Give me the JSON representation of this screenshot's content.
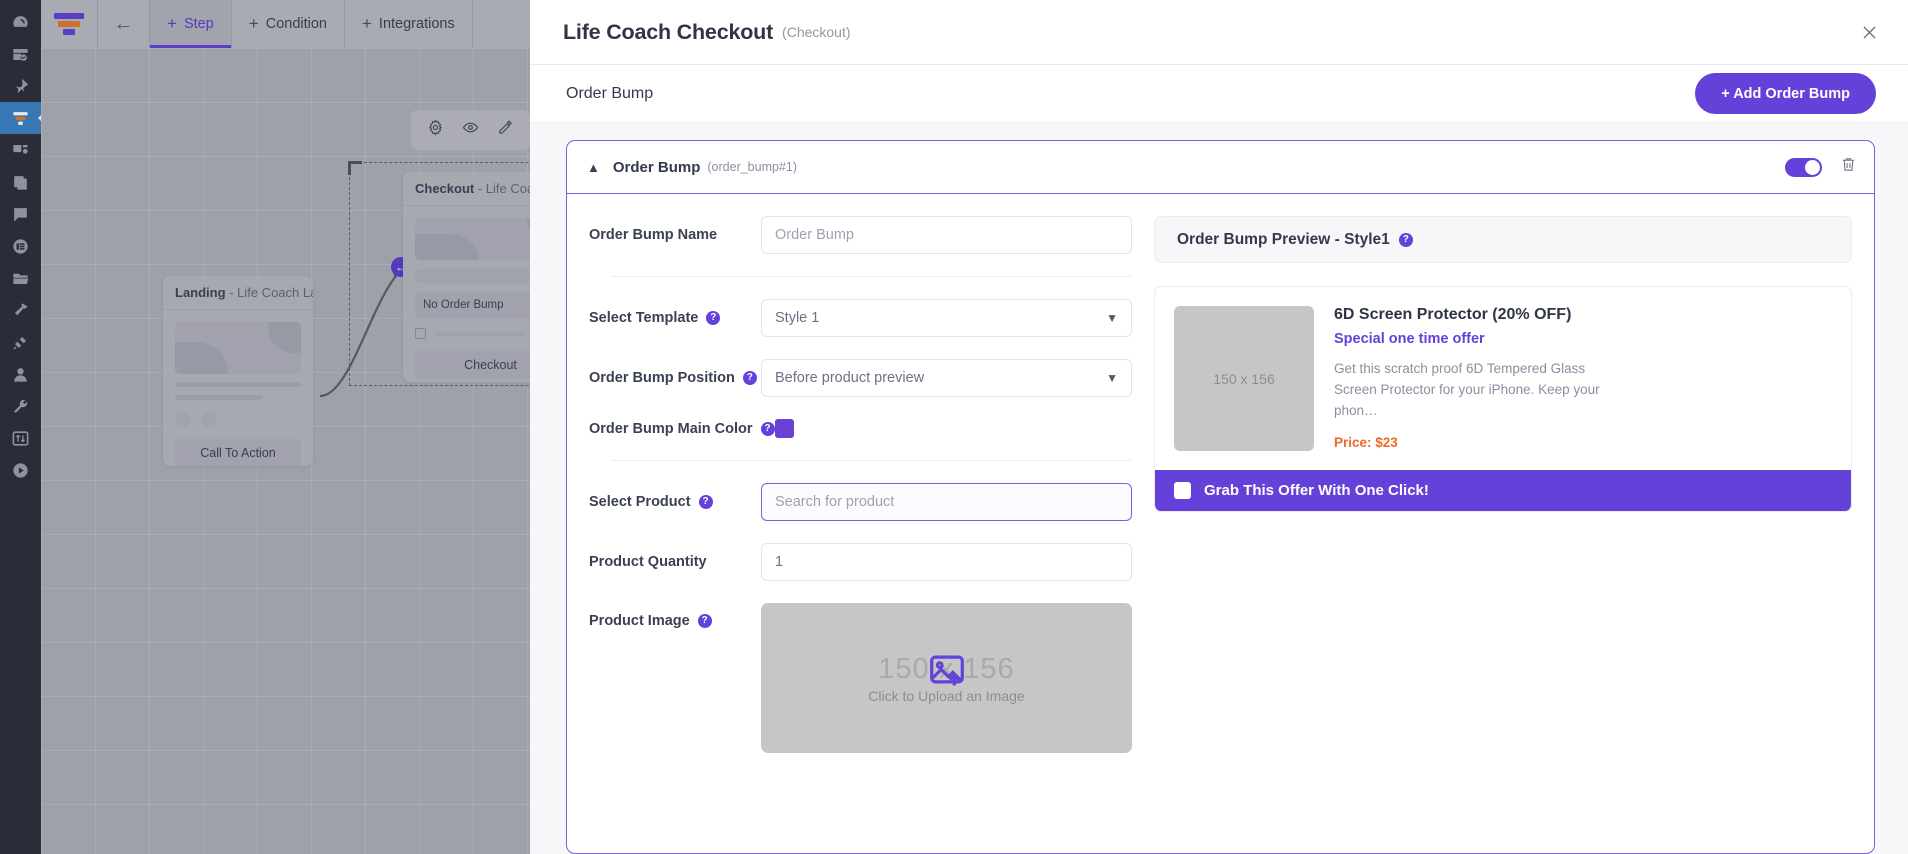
{
  "sidebar": {
    "items": [
      {
        "name": "dashboard-icon",
        "label": "Dashboard"
      },
      {
        "name": "pages-check-icon",
        "label": "Pages"
      },
      {
        "name": "pin-icon",
        "label": "Pinned"
      },
      {
        "name": "funnel-icon",
        "label": "Funnels"
      },
      {
        "name": "media-icon",
        "label": "Media"
      },
      {
        "name": "copy-icon",
        "label": "Templates"
      },
      {
        "name": "chat-icon",
        "label": "Messages"
      },
      {
        "name": "contacts-icon",
        "label": "Contacts"
      },
      {
        "name": "folder-icon",
        "label": "Files"
      },
      {
        "name": "hammer-icon",
        "label": "Builder"
      },
      {
        "name": "plug-icon",
        "label": "Integrations"
      },
      {
        "name": "user-icon",
        "label": "Users"
      },
      {
        "name": "wrench-icon",
        "label": "Tools"
      },
      {
        "name": "sliders-icon",
        "label": "Settings"
      },
      {
        "name": "play-icon",
        "label": "Tutorials"
      }
    ],
    "active_index": 3
  },
  "topbar": {
    "back_label": "←",
    "items": [
      {
        "label": "Step",
        "plus": "+",
        "active": true
      },
      {
        "label": "Condition",
        "plus": "+",
        "active": false
      },
      {
        "label": "Integrations",
        "plus": "+",
        "active": false
      }
    ]
  },
  "canvas": {
    "landing_node": {
      "type": "Landing",
      "name": "- Life Coach Lan…",
      "button_label": "Call To Action"
    },
    "checkout_node": {
      "type": "Checkout",
      "name": "- Life Coach",
      "bump_label": "No Order Bump",
      "button_label": "Checkout"
    },
    "node_toolbar": [
      {
        "name": "gear-icon"
      },
      {
        "name": "eye-icon"
      },
      {
        "name": "pencil-icon"
      }
    ]
  },
  "modal": {
    "title": "Life Coach Checkout",
    "subtitle": "(Checkout)",
    "close_label": "✕",
    "section_title": "Order Bump",
    "add_button": "+ Add Order Bump"
  },
  "bump": {
    "header": {
      "chevron": "⌃",
      "title": "Order Bump",
      "id": "(order_bump#1)",
      "enabled": true
    },
    "fields": {
      "name_label": "Order Bump Name",
      "name_placeholder": "Order Bump",
      "name_value": "",
      "template_label": "Select Template",
      "template_value": "Style 1",
      "position_label": "Order Bump Position",
      "position_value": "Before product preview",
      "color_label": "Order Bump Main Color",
      "color_value": "#6941d6",
      "product_label": "Select Product",
      "product_placeholder": "Search for product",
      "product_value": "",
      "quantity_label": "Product Quantity",
      "quantity_value": "1",
      "image_label": "Product Image",
      "image_dimensions": "150 x 156",
      "image_upload_text": "Click to Upload an Image",
      "help_glyph": "?"
    }
  },
  "preview": {
    "header_title": "Order Bump Preview - Style1",
    "help_glyph": "?",
    "image_placeholder": "150 x 156",
    "product_title": "6D Screen Protector (20% OFF)",
    "special_text": "Special one time offer",
    "description": "Get this scratch proof 6D Tempered Glass Screen Protector for your iPhone. Keep your phon…",
    "price": "Price: $23",
    "cta_label": "Grab This Offer With One Click!"
  },
  "colors": {
    "brand_purple": "#6441d8",
    "price_orange": "#ec6a2c",
    "sidebar_dark": "#2b2f3a",
    "active_rail": "#3b82c4"
  }
}
